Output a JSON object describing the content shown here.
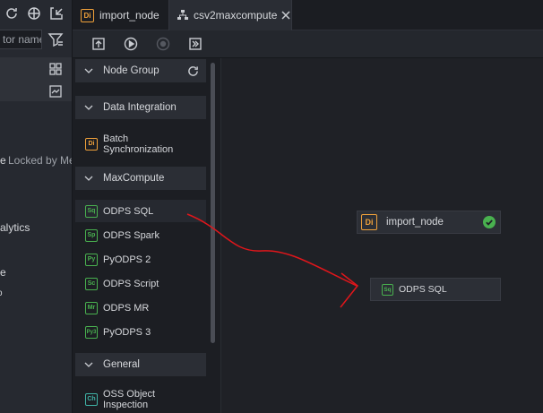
{
  "left_panel": {
    "search_placeholder": "tor name",
    "text_e": "e",
    "locked_label": "Locked by Me",
    "text_alytics": "alytics",
    "text_e2": "e"
  },
  "tabs": [
    {
      "label": "import_node",
      "badge": "Di"
    },
    {
      "label": "csv2maxcompute",
      "active": true
    }
  ],
  "node_panel": {
    "groups": {
      "node_group": "Node Group",
      "data_integration": "Data Integration",
      "maxcompute": "MaxCompute",
      "general": "General"
    },
    "items": {
      "batch_sync": {
        "label": "Batch Synchronization",
        "badge": "Di"
      },
      "odps_sql": {
        "label": "ODPS SQL",
        "badge": "Sq"
      },
      "odps_spark": {
        "label": "ODPS Spark",
        "badge": "Sp"
      },
      "pyodps2": {
        "label": "PyODPS 2",
        "badge": "Py"
      },
      "odps_script": {
        "label": "ODPS Script",
        "badge": "Sc"
      },
      "odps_mr": {
        "label": "ODPS MR",
        "badge": "Mr"
      },
      "pyodps3": {
        "label": "PyODPS 3",
        "badge": "Py3"
      },
      "oss_object": {
        "label": "OSS Object Inspection",
        "badge": "Ch"
      }
    }
  },
  "canvas": {
    "import_node": {
      "label": "import_node",
      "badge": "Di"
    },
    "odps_sql_node": {
      "label": "ODPS SQL",
      "badge": "Sq"
    }
  },
  "colors": {
    "accent_orange": "#f0a13a",
    "accent_green": "#49b14f",
    "annotation_red": "#e0161b"
  }
}
